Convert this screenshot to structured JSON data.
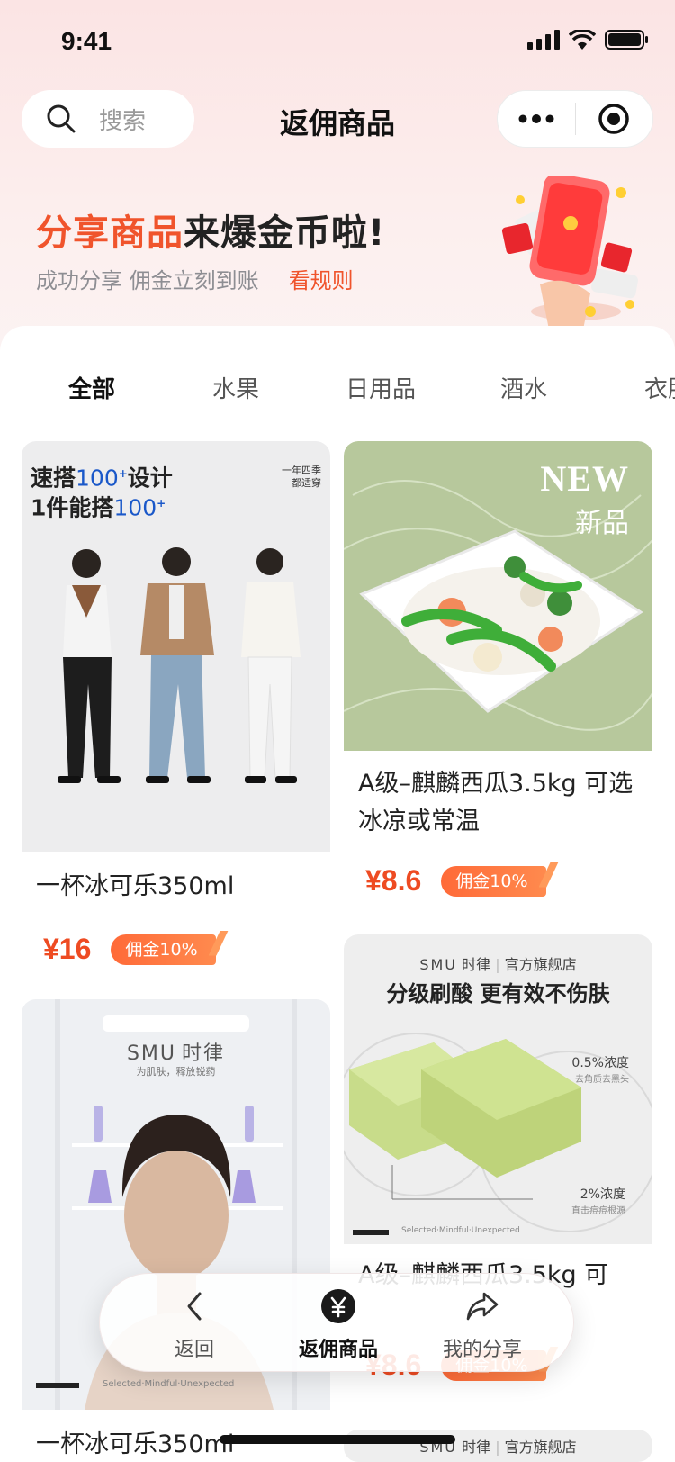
{
  "status": {
    "time": "9:41"
  },
  "nav": {
    "search_label": "搜索",
    "title": "返佣商品"
  },
  "banner": {
    "title_highlight": "分享商品",
    "title_rest": "来爆金币啦!",
    "subtitle": "成功分享 佣金立刻到账",
    "rule_link": "看规则"
  },
  "tabs": [
    "全部",
    "水果",
    "日用品",
    "酒水",
    "衣服"
  ],
  "products": [
    {
      "image_text": {
        "line1": "速搭",
        "num1": "100",
        "suffix1": "设计",
        "line2": "1件能搭",
        "num2": "100",
        "tag": "一年四季 都适穿"
      },
      "title": "一杯冰可乐350ml",
      "price": "¥16",
      "commission": "佣金10%"
    },
    {
      "image_text": {
        "new_en": "NEW",
        "new_cn": "新品"
      },
      "title": "A级–麒麟西瓜3.5kg 可选冰凉或常温",
      "price": "¥8.6",
      "commission": "佣金10%"
    },
    {
      "image_text": {
        "brand": "SMU",
        "brand_cn": "时律",
        "slogan": "为肌肤，释放锐药",
        "footer": "Selected·Mindful·Unexpected"
      },
      "title": "一杯冰可乐350ml"
    },
    {
      "image_text": {
        "brand": "SMU",
        "brand_cn": "时律",
        "store": "官方旗舰店",
        "headline": "分级刷酸 更有效不伤肤",
        "tag1": "0.5%浓度",
        "tag1_sub": "去角质去黑头",
        "tag2": "2%浓度",
        "tag2_sub": "直击痘痘根源",
        "footer": "Selected·Mindful·Unexpected"
      },
      "title": "A级–麒麟西瓜3.5kg 可",
      "price": "¥8.6",
      "commission": "佣金10%"
    },
    {
      "image_text": {
        "brand": "SMU",
        "brand_cn": "时律",
        "store": "官方旗舰店"
      }
    }
  ],
  "float_bar": {
    "back": "返回",
    "rebate": "返佣商品",
    "my_share": "我的分享"
  },
  "colors": {
    "accent": "#f0542c",
    "price": "#ee4b22"
  }
}
